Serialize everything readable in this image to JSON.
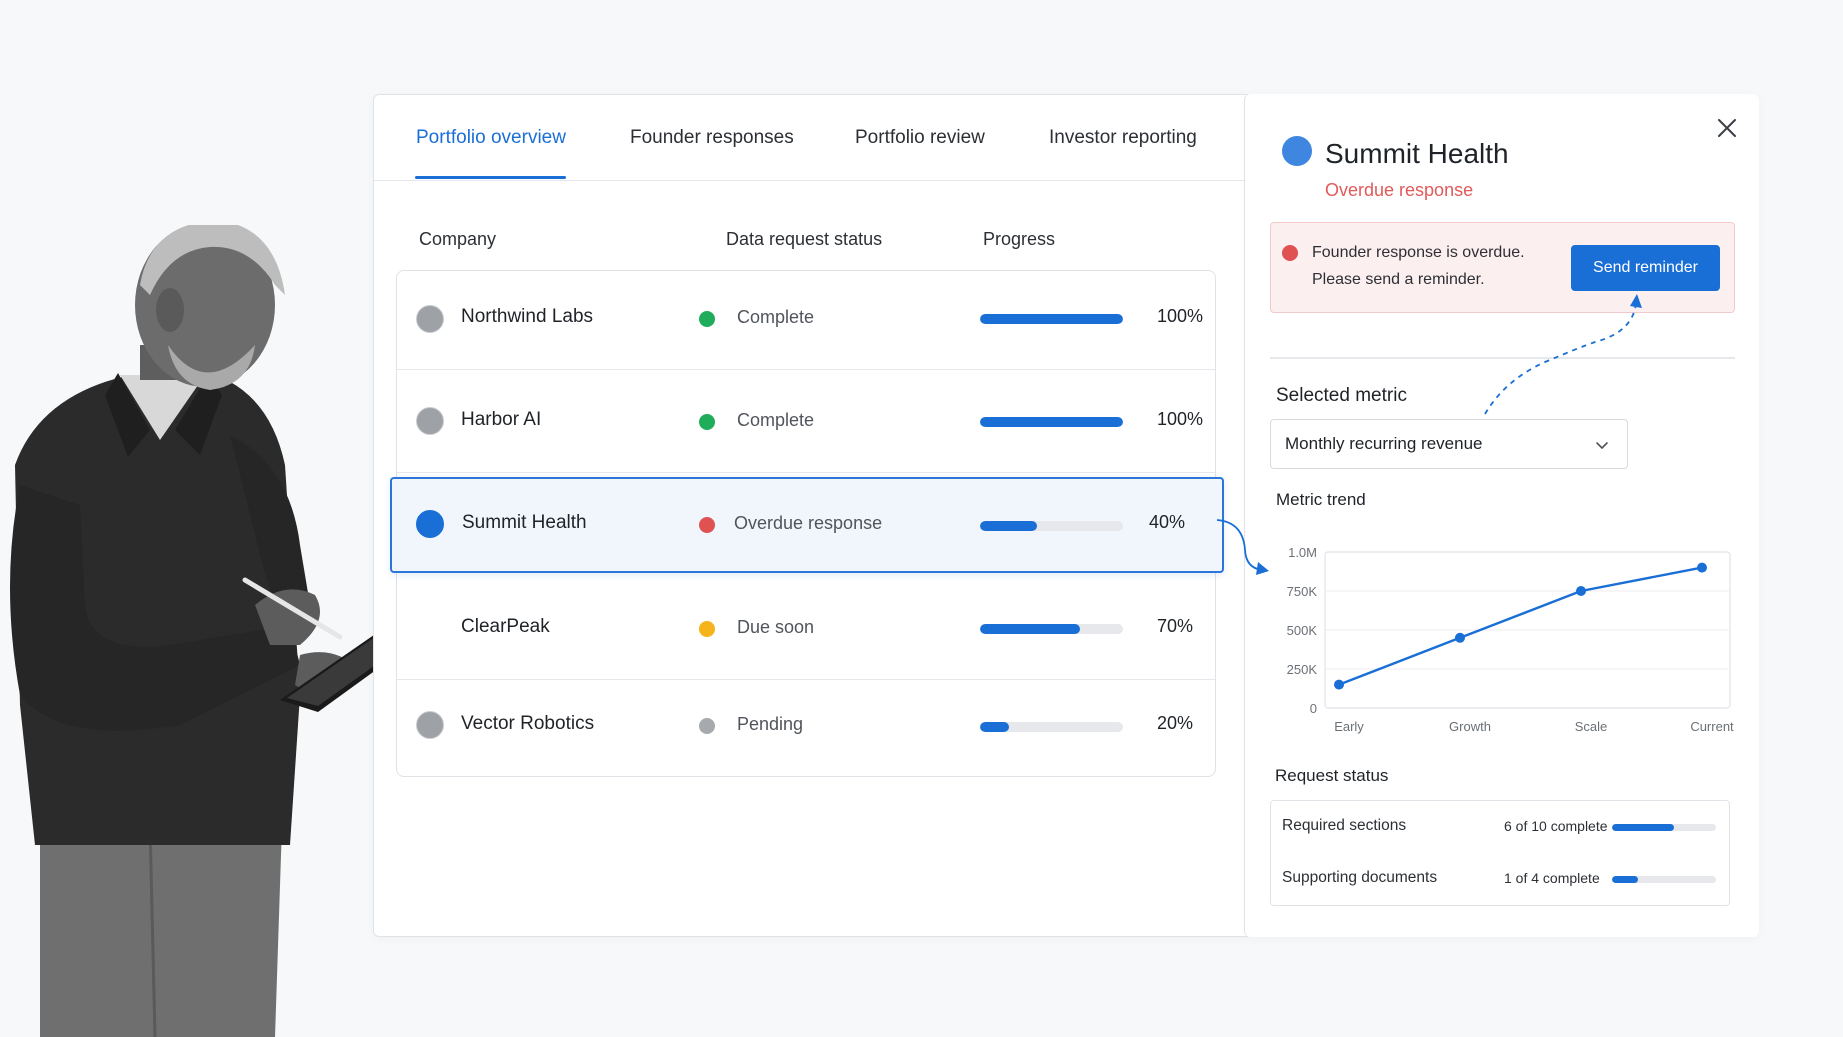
{
  "tabs": [
    {
      "label": "Portfolio overview",
      "active": true
    },
    {
      "label": "Founder responses",
      "active": false
    },
    {
      "label": "Portfolio review",
      "active": false
    },
    {
      "label": "Investor reporting",
      "active": false
    }
  ],
  "table": {
    "headers": {
      "company": "Company",
      "status": "Data request status",
      "progress": "Progress"
    },
    "rows": [
      {
        "company": "Northwind Labs",
        "status": "Complete",
        "status_color": "#1fad5b",
        "progress": 1.0,
        "progress_label": "100%",
        "avatar_color": "gray",
        "selected": false
      },
      {
        "company": "Harbor AI",
        "status": "Complete",
        "status_color": "#1fad5b",
        "progress": 1.0,
        "progress_label": "100%",
        "avatar_color": "gray",
        "selected": false
      },
      {
        "company": "Summit Health",
        "status": "Overdue response",
        "status_color": "#e05252",
        "progress": 0.4,
        "progress_label": "40%",
        "avatar_color": "blue",
        "selected": true
      },
      {
        "company": "ClearPeak",
        "status": "Due soon",
        "status_color": "#f4b41a",
        "progress": 0.7,
        "progress_label": "70%",
        "avatar_color": "none",
        "selected": false
      },
      {
        "company": "Vector Robotics",
        "status": "Pending",
        "status_color": "#a6a9ad",
        "progress": 0.2,
        "progress_label": "20%",
        "avatar_color": "gray",
        "selected": false
      }
    ]
  },
  "detail": {
    "title": "Summit Health",
    "subtitle": "Overdue response",
    "close_icon": "close-icon",
    "alert": {
      "line1": "Founder response is overdue.",
      "line2": "Please send a reminder.",
      "button_label": "Send reminder"
    },
    "metric": {
      "label": "Selected metric",
      "selected_value": "Monthly recurring revenue"
    },
    "trend": {
      "label": "Metric trend"
    },
    "request_status": {
      "label": "Request status",
      "items": [
        {
          "name": "Required sections",
          "count": "6 of 10 complete",
          "progress": 0.6
        },
        {
          "name": "Supporting documents",
          "count": "1 of 4 complete",
          "progress": 0.25
        }
      ]
    }
  },
  "chart_data": {
    "type": "line",
    "categories": [
      "Early",
      "Growth",
      "Scale",
      "Current"
    ],
    "series": [
      {
        "values": [
          150000,
          450000,
          750000,
          900000
        ]
      }
    ],
    "y_ticks": [
      "0",
      "250K",
      "500K",
      "750K",
      "1.0M"
    ],
    "ylim": [
      0,
      1000000
    ],
    "grid": true,
    "color": "#1a6fd6"
  },
  "colors": {
    "accent": "#1a6fd6",
    "danger": "#e05252",
    "success": "#1fad5b",
    "warning": "#f4b41a",
    "neutral": "#a6a9ad"
  }
}
